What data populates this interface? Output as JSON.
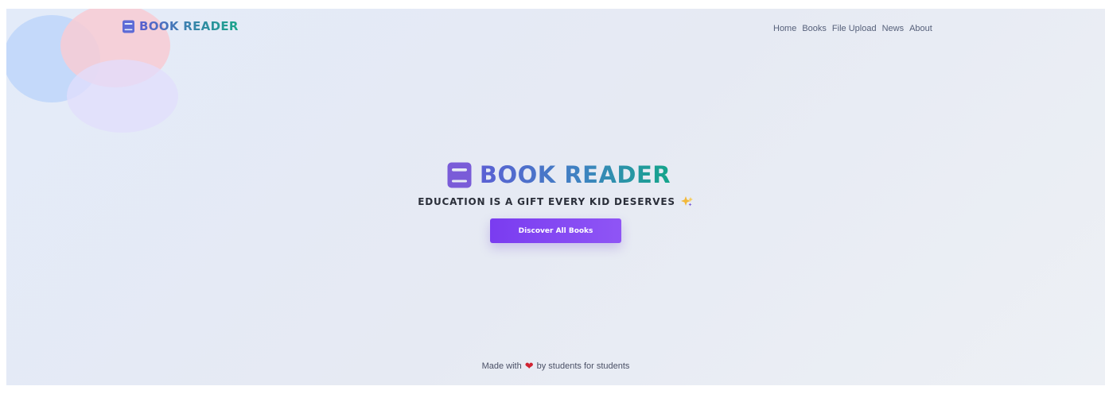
{
  "header": {
    "logo_text": "BOOK READER",
    "logo_icon": "book-icon"
  },
  "nav": {
    "items": [
      {
        "label": "Home"
      },
      {
        "label": "Books"
      },
      {
        "label": "File Upload"
      },
      {
        "label": "News"
      },
      {
        "label": "About"
      }
    ]
  },
  "hero": {
    "title": "BOOK READER",
    "title_icon": "book-icon",
    "tagline": "EDUCATION IS A GIFT EVERY KID DESERVES",
    "tagline_icon": "sparkle-icon",
    "cta_label": "Discover All Books"
  },
  "footer": {
    "prefix": "Made with",
    "heart": "❤",
    "suffix": "by students for students"
  },
  "colors": {
    "accent_purple": "#7a3cf0",
    "logo_gradient_start": "#5a5fd0",
    "logo_gradient_end": "#1aa58a",
    "heart_red": "#d02332"
  }
}
